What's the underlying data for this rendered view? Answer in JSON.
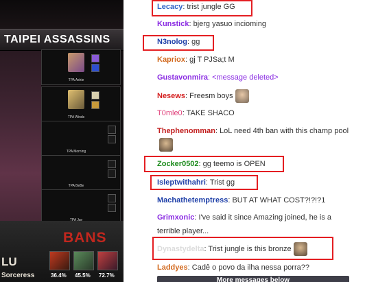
{
  "stream": {
    "team_name": "TAIPEI ASSASSINS",
    "players": [
      "TPA Ashie",
      "TPA Winds",
      "TPA Morning",
      "TPA BeBe",
      "TPA Jay"
    ],
    "bans_label": "BANS",
    "ban_rates": [
      "36.4%",
      "45.5%",
      "72.7%"
    ],
    "player_tag_top": "LU",
    "player_tag_bottom": "Sorceress"
  },
  "chat": {
    "messages": [
      {
        "user": "Lecacy",
        "color": "#2f63c7",
        "text": ": trist jungle GG",
        "emote": ""
      },
      {
        "user": "Kunstick",
        "color": "#8a2be2",
        "text": ": bjerg yasuo incioming",
        "emote": ""
      },
      {
        "user": "N3nolog",
        "color": "#1e3fa8",
        "text": ": gg",
        "emote": ""
      },
      {
        "user": "Kapriox",
        "color": "#d2691e",
        "text": ": gj T PJSa;t M",
        "emote": ""
      },
      {
        "user": "Gustavonmira",
        "color": "#8a2be2",
        "text": ": <message deleted>",
        "emote": ""
      },
      {
        "user": "Nesews",
        "color": "#d42020",
        "text": ": Freesm boys",
        "emote": "face-emote"
      },
      {
        "user": "T0mle0",
        "color": "#e0407a",
        "text": ": TAKE SHACO",
        "emote": ""
      },
      {
        "user": "Thephenomman",
        "color": "#c22020",
        "text": ": LoL need 4th ban with this champ pool",
        "emote": "kappa-emote"
      },
      {
        "user": "Zocker0502",
        "color": "#1a8a1a",
        "text": ": gg teemo is OPEN",
        "emote": ""
      },
      {
        "user": "Isleptwithahri",
        "color": "#1e3fa8",
        "text": ": Trist gg",
        "emote": ""
      },
      {
        "user": "Machathetemptress",
        "color": "#1e3fa8",
        "text": ": BUT AT WHAT COST?!?!?1",
        "emote": ""
      },
      {
        "user": "Grimxonic",
        "color": "#8a2be2",
        "text": ": I've said it since Amazing joined, he is a terrible player...",
        "emote": ""
      },
      {
        "user": "Dynastydelta",
        "color": "#dcdcdc",
        "text": ": Trist jungle is this bronze",
        "emote": "kappa-emote"
      },
      {
        "user": "Laddyes",
        "color": "#d2691e",
        "text": ": Cadê o povo da ilha nessa porra??",
        "emote": ""
      }
    ],
    "more_messages_label": "More messages below"
  }
}
